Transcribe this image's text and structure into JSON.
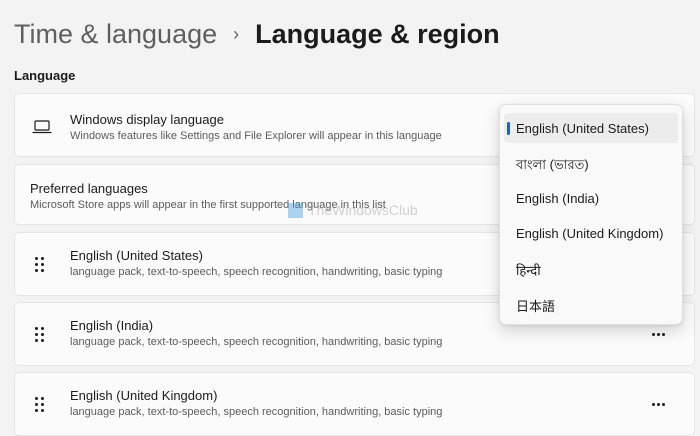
{
  "breadcrumb": {
    "parent": "Time & language",
    "separator": "›",
    "current": "Language & region"
  },
  "section": {
    "label": "Language"
  },
  "display_language": {
    "title": "Windows display language",
    "description": "Windows features like Settings and File Explorer will appear in this language",
    "icon": "laptop-icon"
  },
  "preferred_languages": {
    "title": "Preferred languages",
    "description": "Microsoft Store apps will appear in the first supported language in this list"
  },
  "languages": [
    {
      "name": "English (United States)",
      "features": "language pack, text-to-speech, speech recognition, handwriting, basic typing"
    },
    {
      "name": "English (India)",
      "features": "language pack, text-to-speech, speech recognition, handwriting, basic typing"
    },
    {
      "name": "English (United Kingdom)",
      "features": "language pack, text-to-speech, speech recognition, handwriting, basic typing"
    }
  ],
  "dropdown": {
    "selected": "English (United States)",
    "options": [
      "English (United States)",
      "বাংলা (ভারত)",
      "English (India)",
      "English (United Kingdom)",
      "हिन्दी",
      "日本語"
    ]
  },
  "watermark": {
    "text": "TheWindowsClub"
  },
  "colors": {
    "accent": "#1f5fbf",
    "background": "#f3f3f3",
    "card": "#fbfbfb"
  }
}
